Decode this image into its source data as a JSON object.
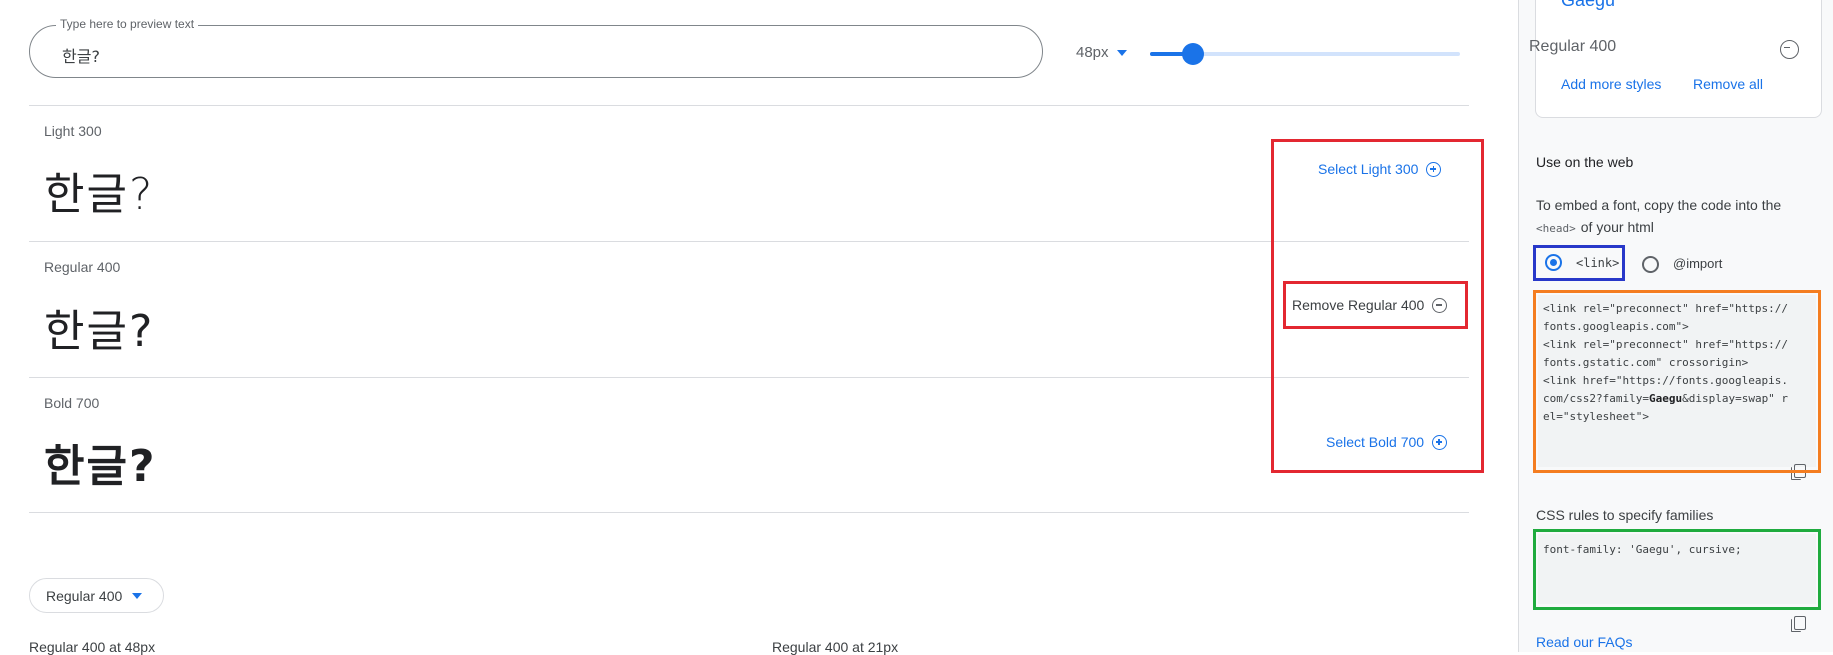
{
  "preview": {
    "label": "Type here to preview text",
    "value": "한글?",
    "size_label": "48px",
    "size_slider_value": 48
  },
  "styles": [
    {
      "name": "Light 300",
      "sample": "한글?",
      "action_label": "Select Light 300",
      "action_icon": "add-circle-icon"
    },
    {
      "name": "Regular 400",
      "sample": "한글?",
      "action_label": "Remove Regular 400",
      "action_icon": "remove-circle-icon"
    },
    {
      "name": "Bold 700",
      "sample": "한글?",
      "action_label": "Select Bold 700",
      "action_icon": "add-circle-icon"
    }
  ],
  "bottom": {
    "style_select_value": "Regular 400",
    "glyph_label_left": "Regular 400 at 48px",
    "glyph_label_right": "Regular 400 at 21px"
  },
  "panel": {
    "family_name": "Gaegu",
    "selected_style": "Regular 400",
    "add_more_styles": "Add more styles",
    "remove_all": "Remove all",
    "use_on_web_title": "Use on the web",
    "embed_text_1": "To embed a font, copy the code into the",
    "embed_head_tag": "<head>",
    "embed_text_2": "of your html",
    "option_link": "<link>",
    "option_import": "@import",
    "link_code": {
      "line1": "<link rel=\"preconnect\" href=\"https://",
      "line2": "fonts.googleapis.com\">",
      "line3": "<link rel=\"preconnect\" href=\"https://",
      "line4": "fonts.gstatic.com\" crossorigin>",
      "line5": "<link href=\"https://fonts.googleapis.",
      "line6_pre": "com/css2?family=",
      "line6_family": "Gaegu",
      "line6_post": "&display=swap\" r",
      "line7": "el=\"stylesheet\">"
    },
    "css_rules_title": "CSS rules to specify families",
    "css_code": "font-family: 'Gaegu', cursive;",
    "faq_link": "Read our FAQs"
  },
  "colors": {
    "accent": "#1a73e8",
    "highlight_red": "#e32831",
    "highlight_blue": "#2838c9",
    "highlight_orange": "#f47d20",
    "highlight_green": "#1fab3e"
  }
}
